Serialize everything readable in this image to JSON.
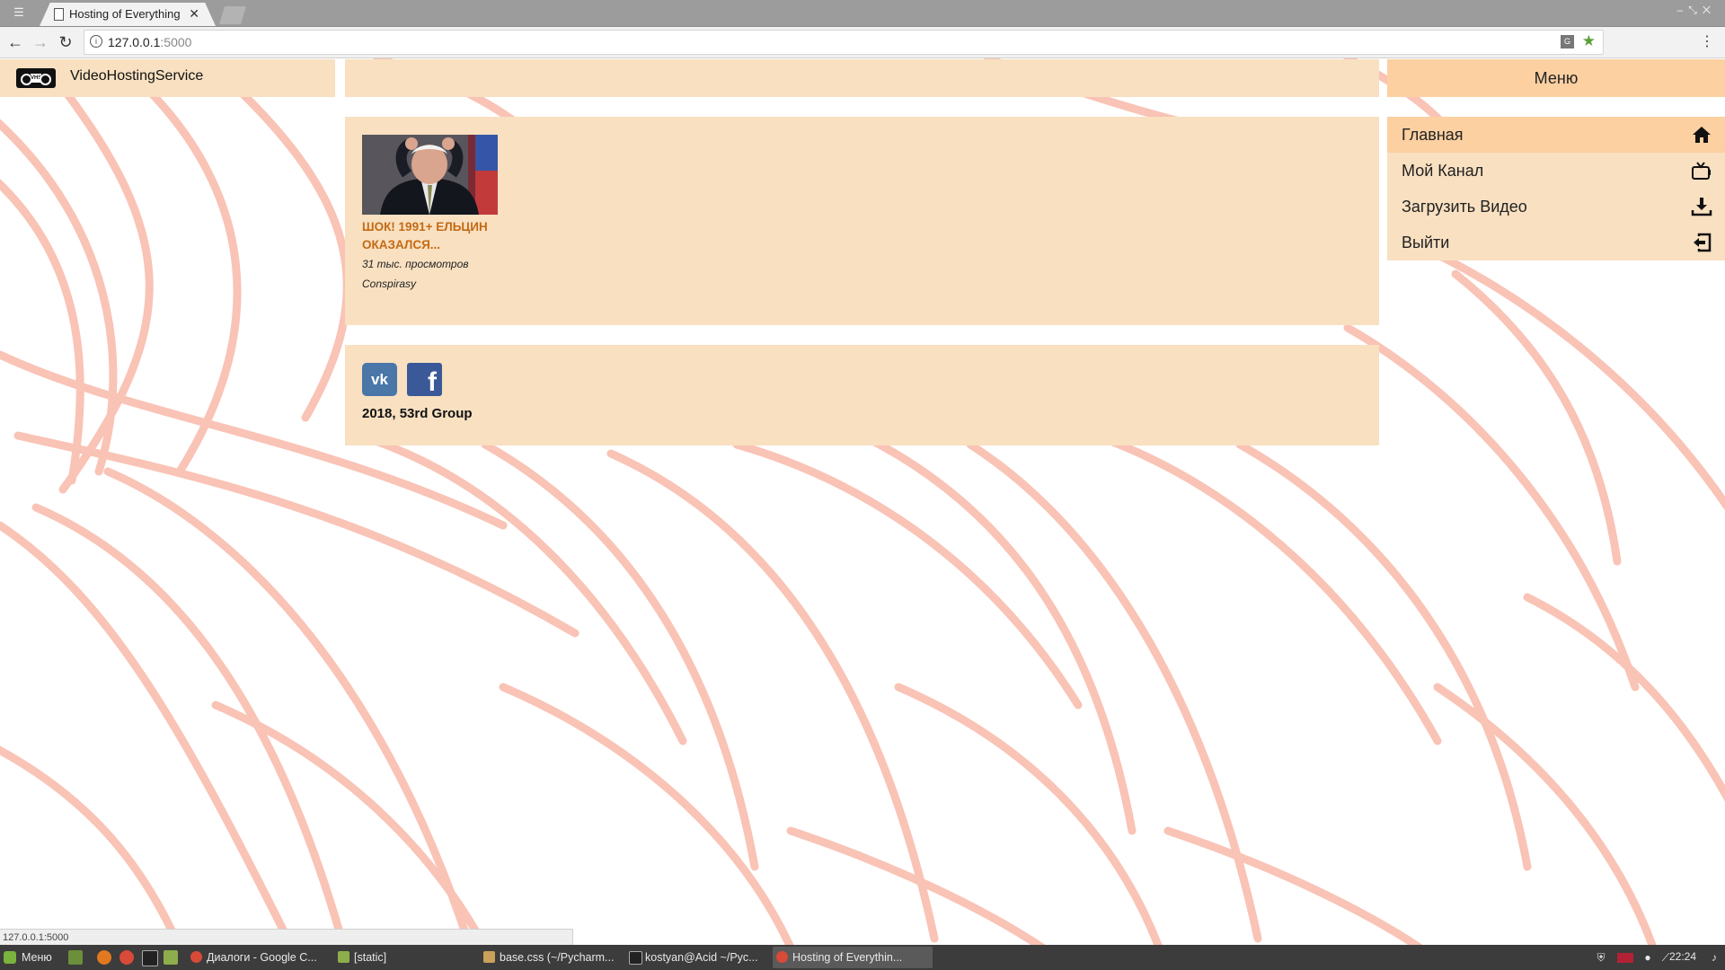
{
  "browser": {
    "tab_title": "Hosting of Everything",
    "tab_close": "✕",
    "url_host": "127.0.0.1",
    "url_port": ":5000",
    "status_url": "127.0.0.1:5000"
  },
  "site": {
    "name": "VideoHostingService",
    "logo_text": "VHS"
  },
  "menu": {
    "header": "Меню",
    "items": [
      {
        "label": "Главная",
        "icon": "home-icon",
        "active": true
      },
      {
        "label": "Мой Канал",
        "icon": "tv-icon",
        "active": false
      },
      {
        "label": "Загрузить Видео",
        "icon": "download-icon",
        "active": false
      },
      {
        "label": "Выйти",
        "icon": "logout-icon",
        "active": false
      }
    ]
  },
  "videos": [
    {
      "title": "ШОК! 1991+ ЕЛЬЦИН ОКАЗАЛСЯ...",
      "views": "31 тыс. просмотров",
      "channel": "Conspirasy"
    }
  ],
  "footer": {
    "vk_label": "vk",
    "fb_label": "f",
    "copyright": "2018, 53rd Group"
  },
  "taskbar": {
    "start_label": "Меню",
    "tasks": [
      {
        "label": "Диалоги - Google C...",
        "active": false
      },
      {
        "label": "[static]",
        "active": false
      },
      {
        "label": "base.css (~/Pycharm...",
        "active": false
      },
      {
        "label": "kostyan@Acid ~/Pyc...",
        "active": false
      },
      {
        "label": "Hosting of Everythin...",
        "active": true
      }
    ],
    "clock": "22:24"
  },
  "colors": {
    "panel": "#f8e0c1",
    "accent": "#fcd0a1",
    "title_link": "#c46a14",
    "pattern": "#f9c3b5"
  }
}
